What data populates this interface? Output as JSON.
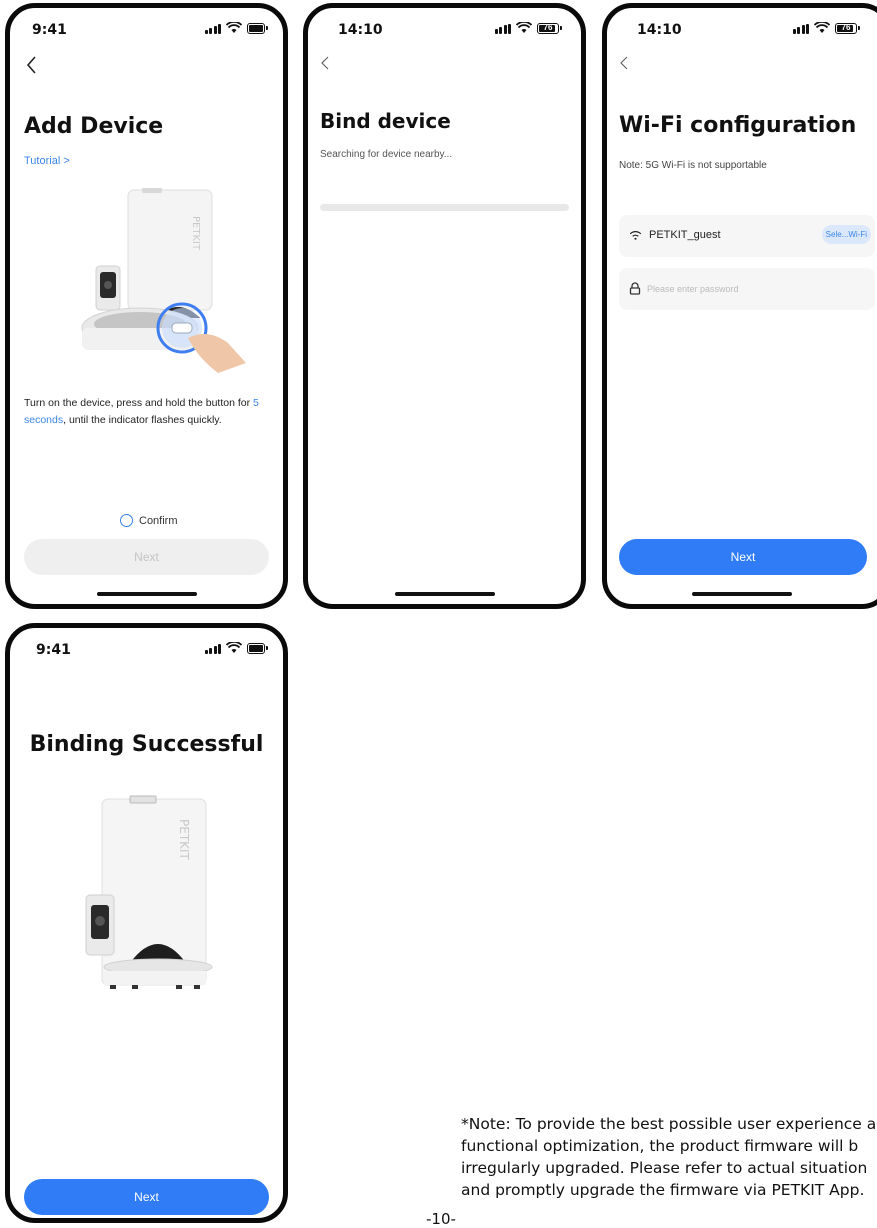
{
  "screens": {
    "add_device": {
      "time": "9:41",
      "title": "Add Device",
      "tutorial_link": "Tutorial >",
      "instruction_part1": "Turn on the device, press and hold the button for ",
      "instruction_highlight1": "5",
      "instruction_highlight2": "seconds",
      "instruction_part2": ", until the indicator flashes quickly.",
      "confirm_label": "Confirm",
      "next_label": "Next"
    },
    "bind_device": {
      "time": "14:10",
      "battery": "76",
      "title": "Bind device",
      "subtitle": "Searching for device nearby..."
    },
    "wifi_config": {
      "time": "14:10",
      "battery": "76",
      "title": "Wi-Fi configuration",
      "note": "Note: 5G Wi-Fi is not supportable",
      "ssid": "PETKIT_guest",
      "select_wifi_label": "Sele...Wi-Fi",
      "password_placeholder": "Please enter password",
      "next_label": "Next"
    },
    "binding_successful": {
      "time": "9:41",
      "title": "Binding Successful",
      "next_label": "Next"
    }
  },
  "device_brand": "PETKIT",
  "footer_note": {
    "line1": "*Note: To provide the best possible user experience a",
    "line2": "functional optimization, the product firmware will b",
    "line3": "irregularly upgraded. Please refer to actual situation",
    "line4": "and promptly upgrade the firmware via PETKIT App."
  },
  "page_number": "-10-",
  "colors": {
    "accent": "#2f7cf6",
    "link": "#3b86e8",
    "disabled_bg": "#efefef",
    "frame": "#0a0a0a"
  }
}
